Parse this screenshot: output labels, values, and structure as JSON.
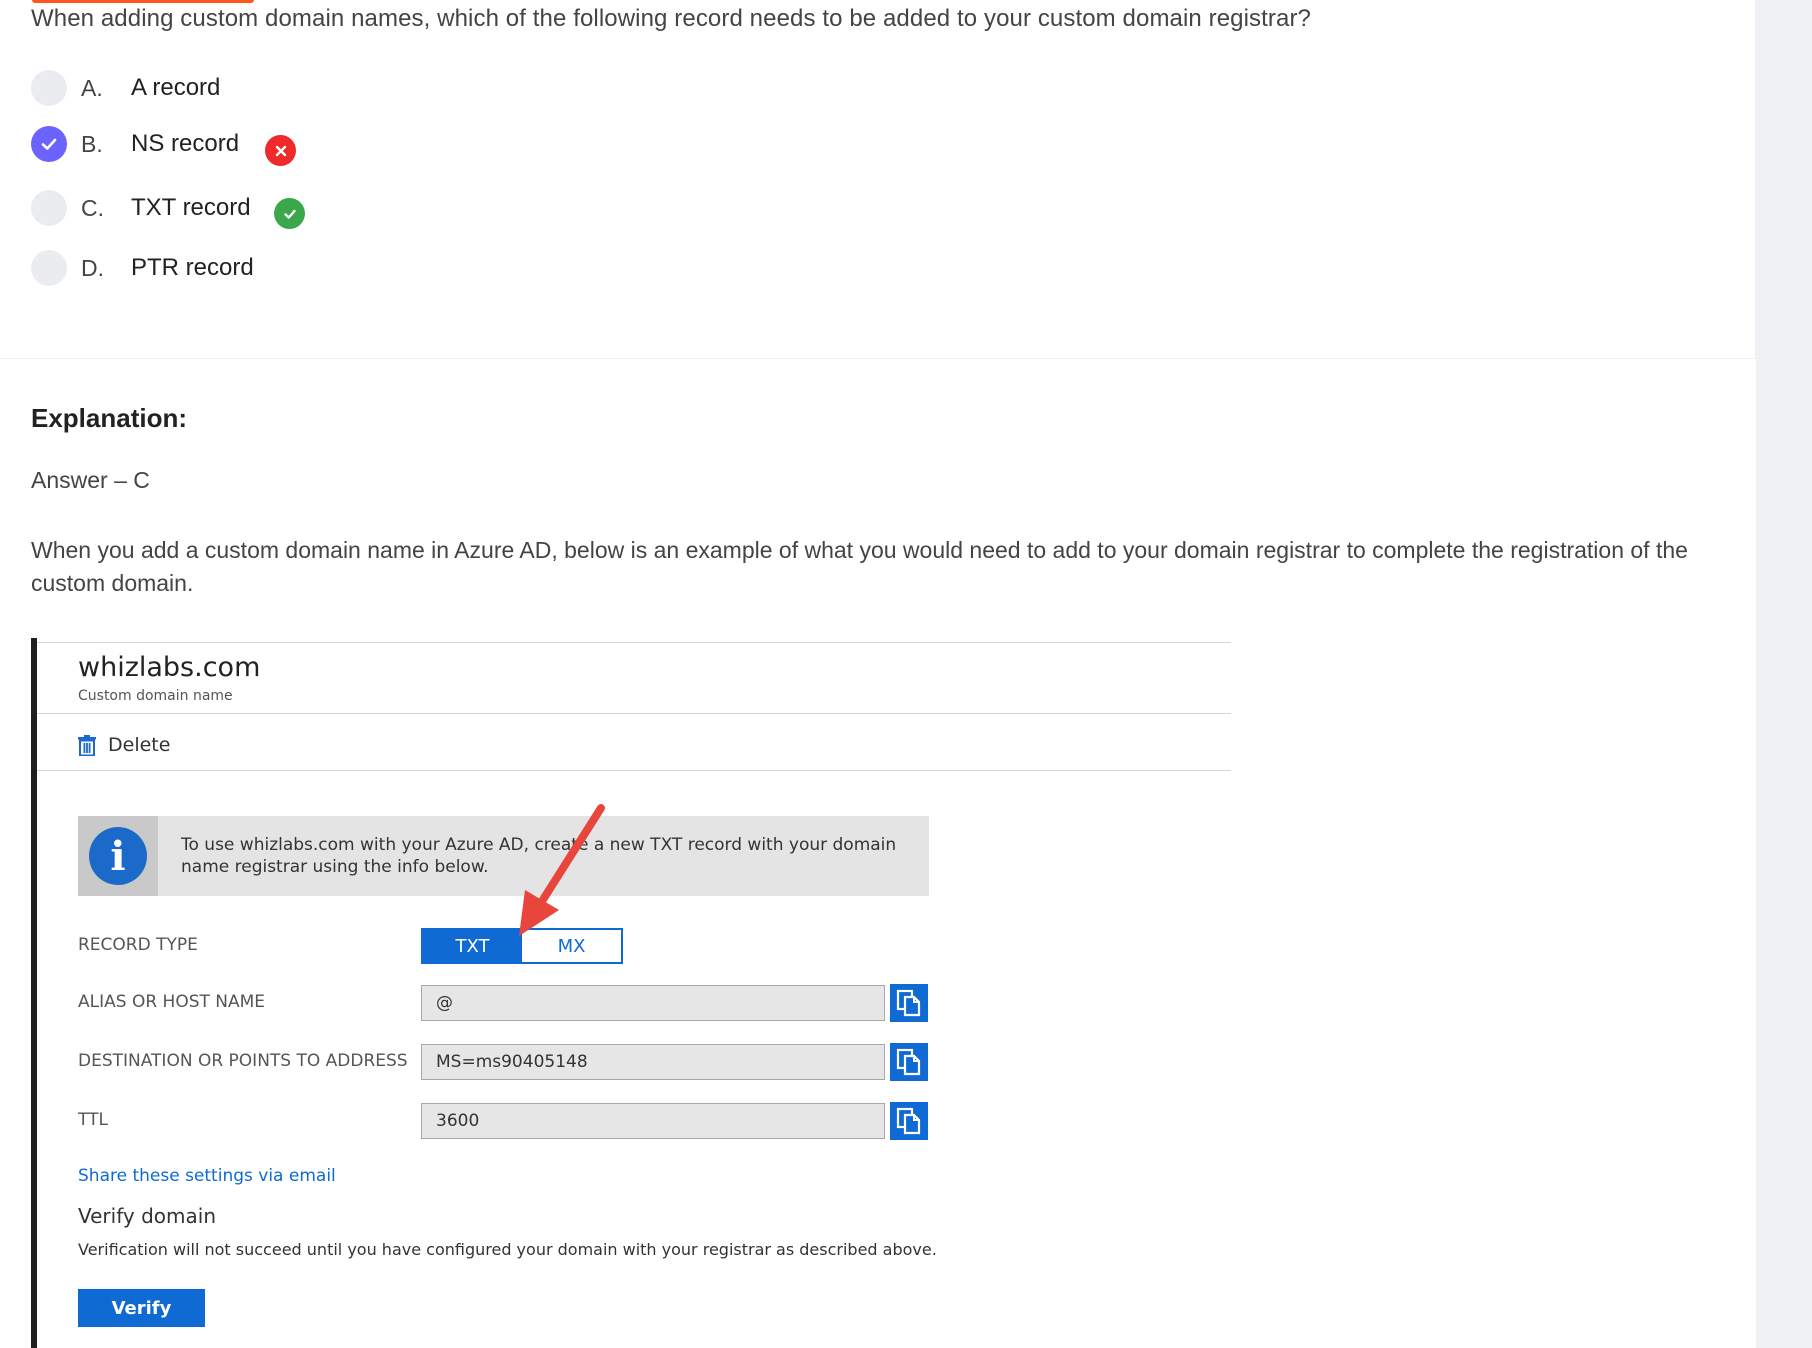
{
  "question": {
    "text": "When adding custom domain names, which of the following record needs to be added to your custom domain registrar?",
    "options": [
      {
        "letter": "A.",
        "text": "A record",
        "selected": false
      },
      {
        "letter": "B.",
        "text": "NS record",
        "selected": true,
        "result": "wrong"
      },
      {
        "letter": "C.",
        "text": "TXT record",
        "selected": false,
        "result": "correct"
      },
      {
        "letter": "D.",
        "text": "PTR record",
        "selected": false
      }
    ]
  },
  "explanation": {
    "title": "Explanation:",
    "answer": "Answer – C",
    "paragraph": "When you add a custom domain name in Azure AD, below is an example of what you would need to add to your domain registrar to complete the registration of the custom domain."
  },
  "azure": {
    "domain_title": "whizlabs.com",
    "domain_subtitle": "Custom domain name",
    "delete_label": "Delete",
    "info_text": "To use whizlabs.com with your Azure AD, create a new TXT record with your domain name registrar using the info below.",
    "record_type_label": "RECORD TYPE",
    "record_type_options": [
      "TXT",
      "MX"
    ],
    "record_type_selected": "TXT",
    "alias_label": "ALIAS OR HOST NAME",
    "alias_value": "@",
    "destination_label": "DESTINATION OR POINTS TO ADDRESS",
    "destination_value": "MS=ms90405148",
    "ttl_label": "TTL",
    "ttl_value": "3600",
    "share_link": "Share these settings via email",
    "verify_title": "Verify domain",
    "verify_text": "Verification will not succeed until you have configured your domain with your registrar as described above.",
    "verify_button": "Verify"
  },
  "colors": {
    "accent": "#ff5722",
    "selected_radio": "#6c63ff",
    "wrong": "#ee2a2a",
    "correct": "#3aa84a",
    "azure_blue": "#0f6ad4",
    "arrow": "#e8453c"
  }
}
